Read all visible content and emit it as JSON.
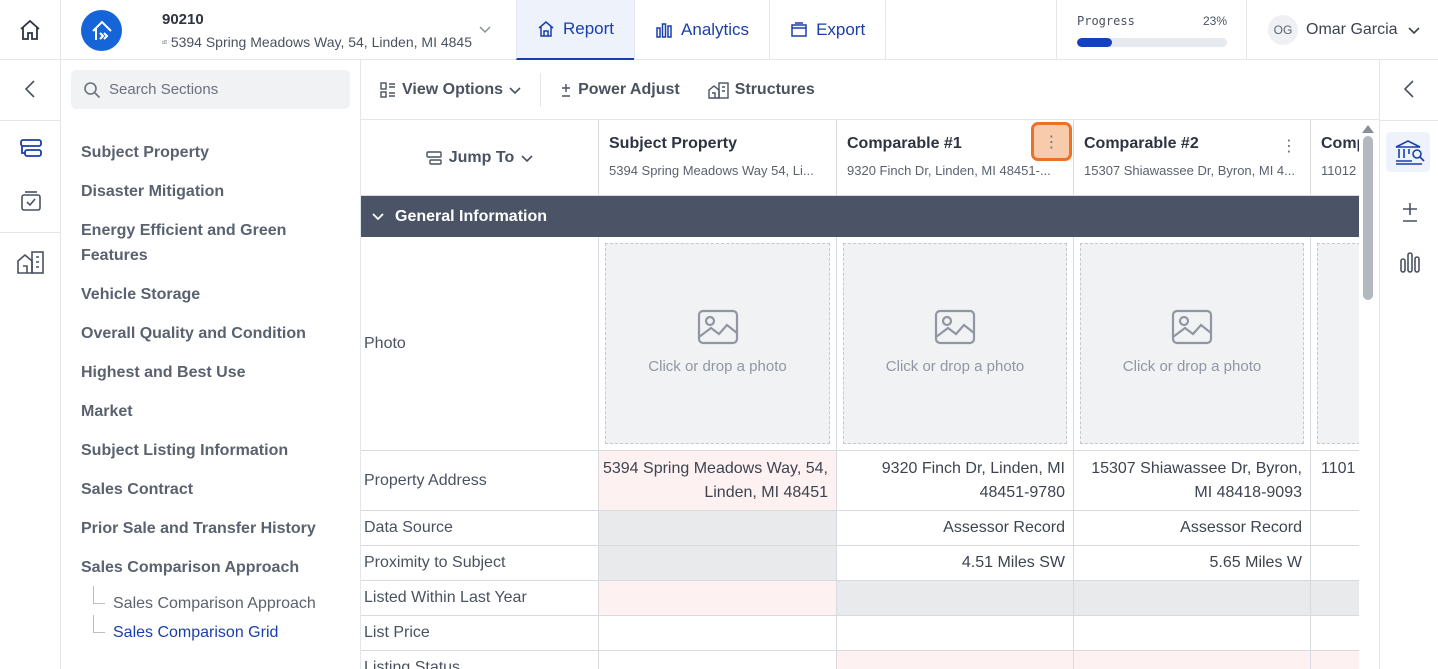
{
  "header": {
    "file_id": "90210",
    "file_address": "5394 Spring Meadows Way, 54, Linden, MI 4845",
    "tabs": [
      {
        "label": "Report",
        "icon": "home-icon",
        "active": true
      },
      {
        "label": "Analytics",
        "icon": "bar-chart-icon",
        "active": false
      },
      {
        "label": "Export",
        "icon": "folder-icon",
        "active": false
      }
    ],
    "progress_label": "Progress",
    "progress_pct": "23%",
    "progress_value": 0.23,
    "user_initials": "OG",
    "user_name": "Omar Garcia"
  },
  "sidebar": {
    "search_placeholder": "Search Sections",
    "items": [
      "Subject Property",
      "Disaster Mitigation",
      "Energy Efficient and Green Features",
      "Vehicle Storage",
      "Overall Quality and Condition",
      "Highest and Best Use",
      "Market",
      "Subject Listing Information",
      "Sales Contract",
      "Prior Sale and Transfer History",
      "Sales Comparison Approach"
    ],
    "subitems": [
      {
        "label": "Sales Comparison Approach",
        "active": false
      },
      {
        "label": "Sales Comparison Grid",
        "active": true
      }
    ]
  },
  "toolbar": {
    "view_options": "View Options",
    "power_adjust": "Power Adjust",
    "structures": "Structures"
  },
  "grid": {
    "jump_to": "Jump To",
    "columns": [
      {
        "title": "Subject Property",
        "subtitle": "5394 Spring Meadows Way 54, Li..."
      },
      {
        "title": "Comparable #1",
        "subtitle": "9320 Finch Dr, Linden, MI 48451-..."
      },
      {
        "title": "Comparable #2",
        "subtitle": "15307 Shiawassee Dr, Byron, MI 4..."
      },
      {
        "title": "Comp",
        "subtitle": "11012"
      }
    ],
    "section_title": "General Information",
    "photo_label": "Photo",
    "photo_prompt": "Click or drop a photo",
    "rows": {
      "property_address": {
        "label": "Property Address",
        "values": [
          "5394 Spring Meadows Way, 54, Linden, MI 48451",
          "9320 Finch Dr, Linden, MI 48451-9780",
          "15307 Shiawassee Dr, Byron, MI 48418-9093",
          "1101"
        ]
      },
      "data_source": {
        "label": "Data Source",
        "values": [
          "",
          "Assessor Record",
          "Assessor Record",
          ""
        ]
      },
      "proximity": {
        "label": "Proximity to Subject",
        "values": [
          "",
          "4.51 Miles SW",
          "5.65 Miles W",
          ""
        ]
      },
      "listed_within": {
        "label": "Listed Within Last Year"
      },
      "list_price": {
        "label": "List Price"
      },
      "listing_status": {
        "label": "Listing Status"
      }
    }
  },
  "colors": {
    "accent": "#1a3fa8",
    "highlight_border": "#ed7125",
    "highlight_fill": "#f8cbad",
    "section_bar": "#4a5466"
  }
}
